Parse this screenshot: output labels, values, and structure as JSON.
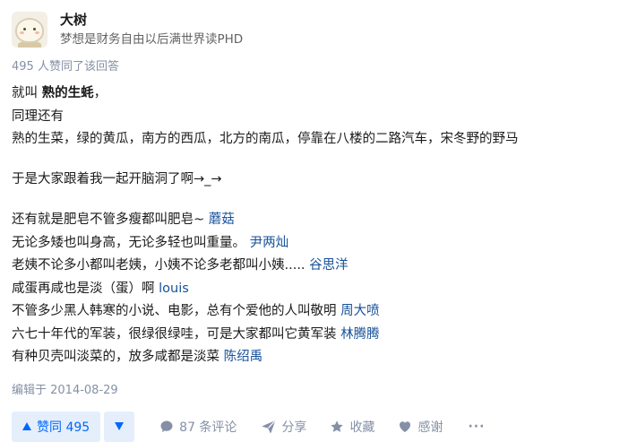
{
  "author": {
    "name": "大树",
    "bio": "梦想是财务自由以后满世界读PHD"
  },
  "votes_line": "495 人赞同了该回答",
  "content": {
    "line1_prefix": "就叫 ",
    "line1_bold": "熟的生蚝",
    "line1_suffix": "，",
    "line2": "同理还有",
    "line3": "熟的生菜，绿的黄瓜，南方的西瓜，北方的南瓜，停靠在八楼的二路汽车，宋冬野的野马",
    "line4": "于是大家跟着我一起开脑洞了啊→_→",
    "quotes": [
      {
        "text": "还有就是肥皂不管多瘦都叫肥皂~ ",
        "user": "蘑菇"
      },
      {
        "text": "无论多矮也叫身高，无论多轻也叫重量。 ",
        "user": "尹两灿"
      },
      {
        "text": "老姨不论多小都叫老姨，小姨不论多老都叫小姨..... ",
        "user": "谷思洋"
      },
      {
        "text": "咸蛋再咸也是淡（蛋）啊 ",
        "user": "louis"
      },
      {
        "text": "不管多少黑人韩寒的小说、电影，总有个爱他的人叫敬明 ",
        "user": "周大喷"
      },
      {
        "text": "六七十年代的军装，很绿很绿哇，可是大家都叫它黄军装 ",
        "user": "林腾腾"
      },
      {
        "text": "有种贝壳叫淡菜的，放多咸都是淡菜 ",
        "user": "陈绍禹"
      }
    ]
  },
  "edited": "编辑于 2014-08-29",
  "actions": {
    "vote_up": "赞同 495",
    "comments": "87 条评论",
    "share": "分享",
    "favorite": "收藏",
    "thanks": "感谢",
    "more": "···"
  },
  "colors": {
    "link": "#175199",
    "meta": "#8590a6",
    "accent": "#0066ff",
    "accent_bg": "#e5effc"
  }
}
